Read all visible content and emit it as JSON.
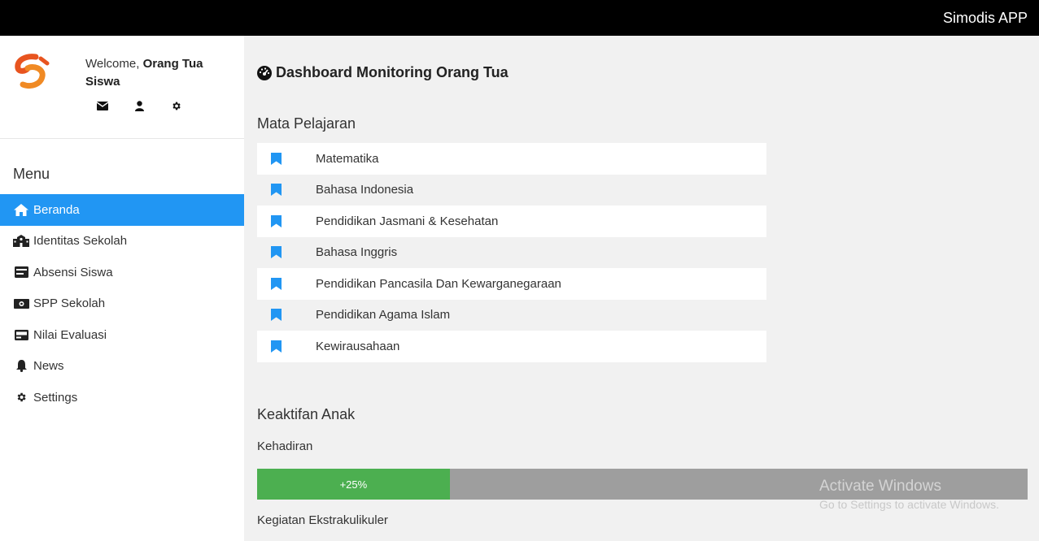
{
  "topbar": {
    "app_title": "Simodis APP"
  },
  "profile": {
    "welcome_prefix": "Welcome, ",
    "user_name": "Orang Tua Siswa",
    "icons": [
      "envelope-icon",
      "user-icon",
      "gear-icon"
    ]
  },
  "sidebar": {
    "menu_title": "Menu",
    "items": [
      {
        "label": "Beranda",
        "icon": "home-icon",
        "active": true
      },
      {
        "label": "Identitas Sekolah",
        "icon": "school-icon"
      },
      {
        "label": "Absensi Siswa",
        "icon": "id-card-icon"
      },
      {
        "label": "SPP Sekolah",
        "icon": "money-icon"
      },
      {
        "label": "Nilai Evaluasi",
        "icon": "report-icon"
      },
      {
        "label": "News",
        "icon": "bell-icon"
      },
      {
        "label": "Settings",
        "icon": "gear-icon"
      }
    ]
  },
  "main": {
    "page_title": "Dashboard Monitoring Orang Tua",
    "subjects_title": "Mata Pelajaran",
    "subjects": [
      "Matematika",
      "Bahasa Indonesia",
      "Pendidikan Jasmani & Kesehatan",
      "Bahasa Inggris",
      "Pendidikan Pancasila Dan Kewarganegaraan",
      "Pendidikan Agama Islam",
      "Kewirausahaan"
    ],
    "activity_title": "Keaktifan Anak",
    "attendance_label": "Kehadiran",
    "attendance": {
      "value": 25,
      "text": "+25%"
    },
    "extracurricular_label": "Kegiatan Ekstrakulikuler"
  },
  "watermark": {
    "title": "Activate Windows",
    "subtitle": "Go to Settings to activate Windows."
  },
  "colors": {
    "topbar": "#000000",
    "active_menu": "#2196f3",
    "bookmark": "#2196f3",
    "progress_fill": "#4caf50",
    "progress_track": "#9e9e9e"
  }
}
